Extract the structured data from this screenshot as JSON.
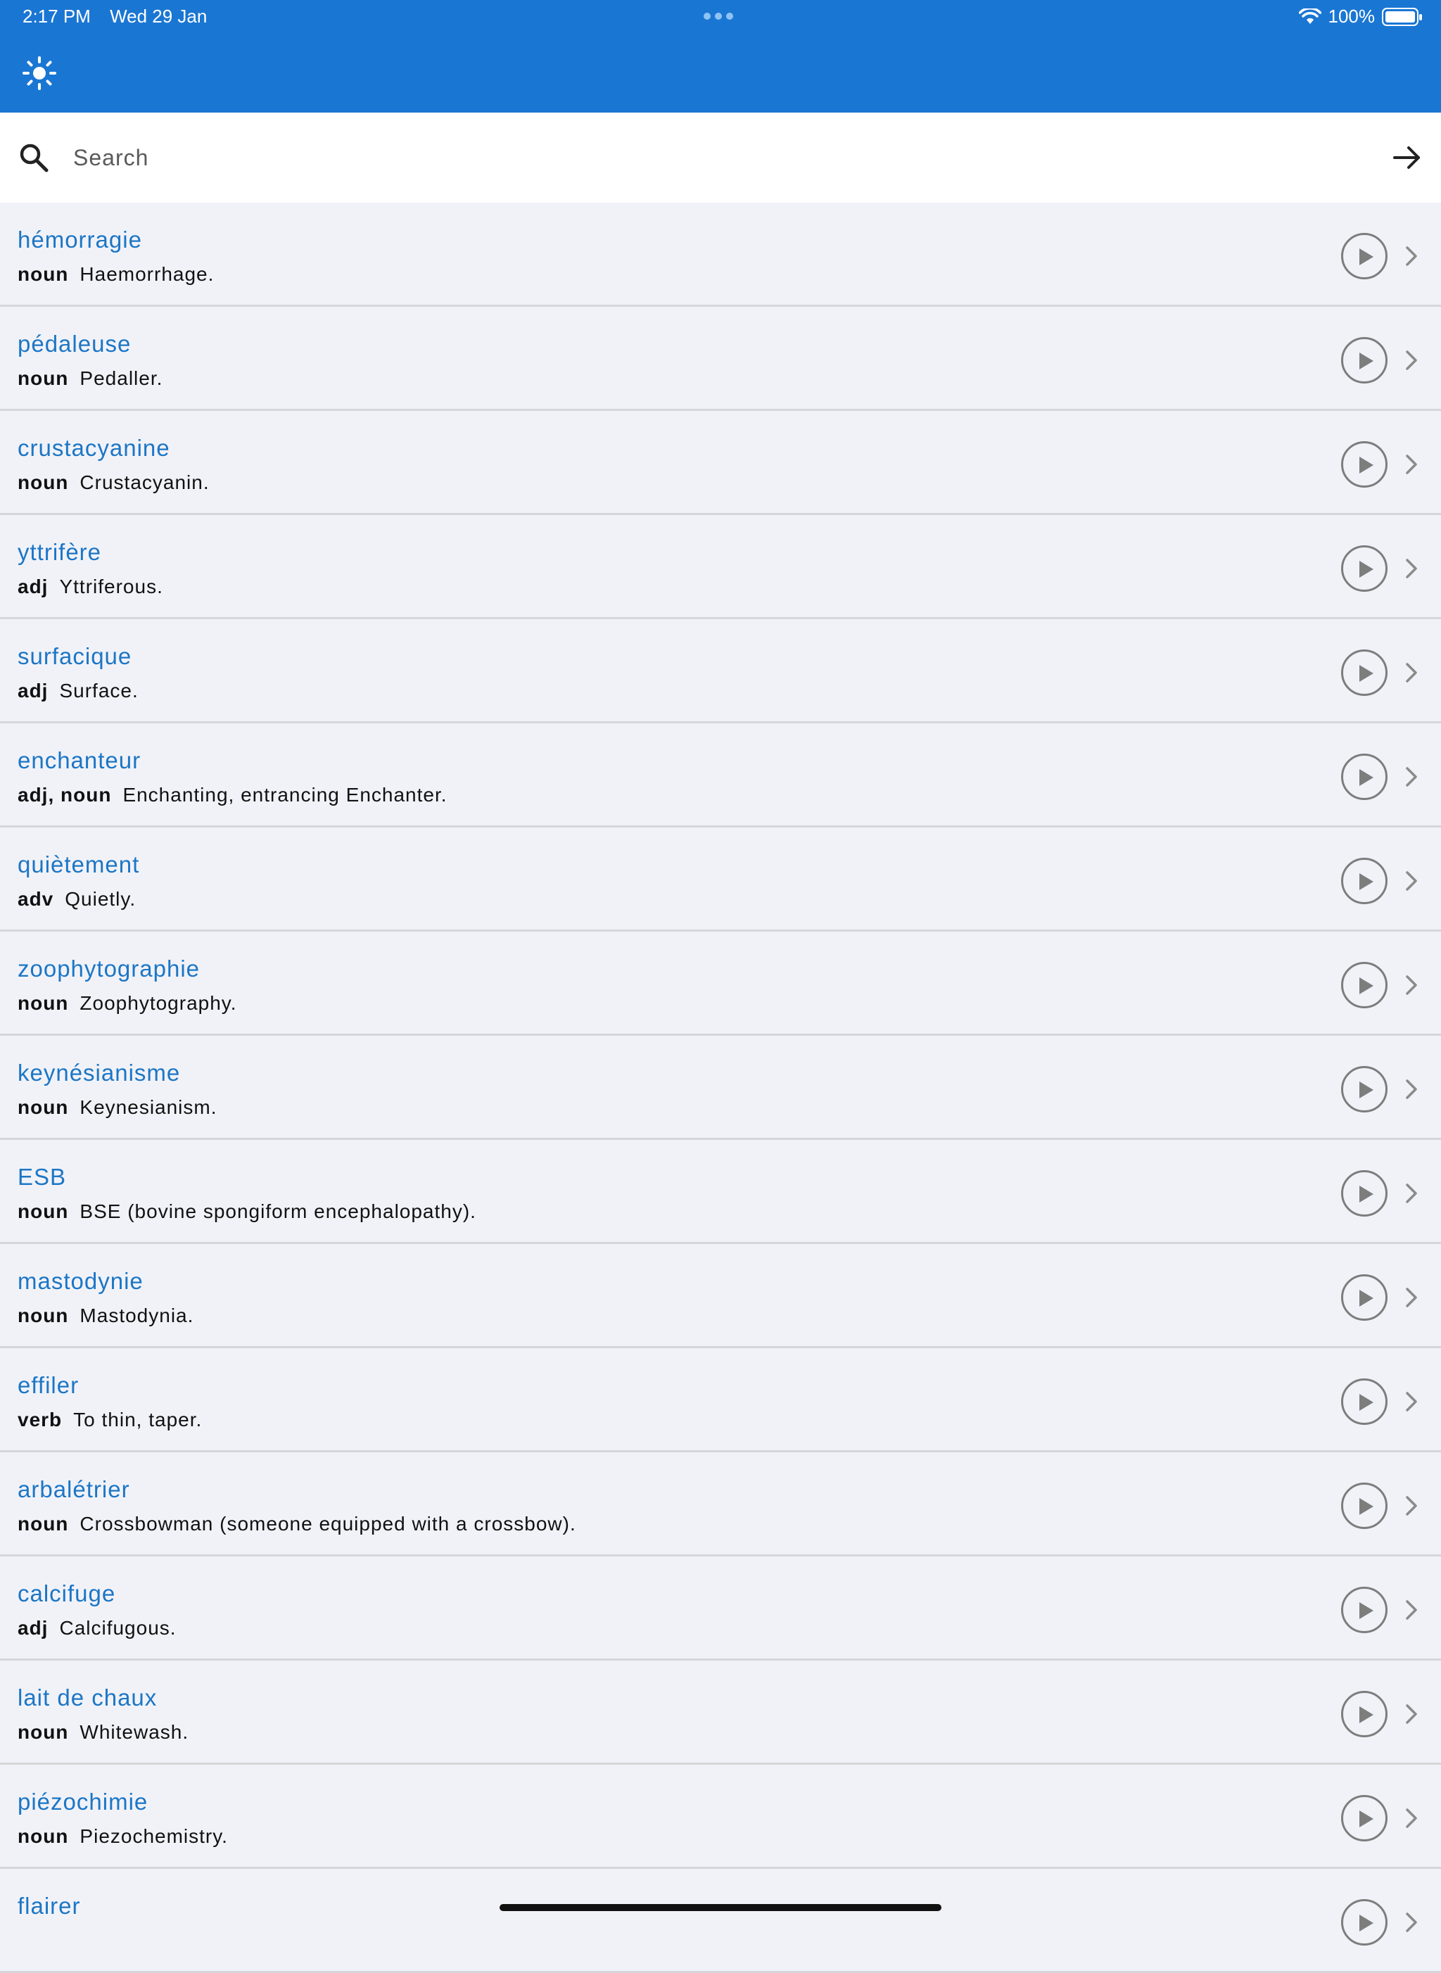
{
  "status_bar": {
    "time": "2:17 PM",
    "date": "Wed 29 Jan",
    "battery": "100%"
  },
  "header": {
    "theme_icon": "sun-icon"
  },
  "search": {
    "placeholder": "Search",
    "value": ""
  },
  "colors": {
    "header": "#1a76d3",
    "word": "#1c76c5",
    "background": "#f1f2f8"
  },
  "entries": [
    {
      "word": "hémorragie",
      "pos": "noun",
      "definition": "Haemorrhage."
    },
    {
      "word": "pédaleuse",
      "pos": "noun",
      "definition": "Pedaller."
    },
    {
      "word": "crustacyanine",
      "pos": "noun",
      "definition": "Crustacyanin."
    },
    {
      "word": "yttrifère",
      "pos": "adj",
      "definition": "Yttriferous."
    },
    {
      "word": "surfacique",
      "pos": "adj",
      "definition": "Surface."
    },
    {
      "word": "enchanteur",
      "pos": "adj, noun",
      "definition": "Enchanting, entrancing Enchanter."
    },
    {
      "word": "quiètement",
      "pos": "adv",
      "definition": "Quietly."
    },
    {
      "word": "zoophytographie",
      "pos": "noun",
      "definition": "Zoophytography."
    },
    {
      "word": "keynésianisme",
      "pos": "noun",
      "definition": "Keynesianism."
    },
    {
      "word": "ESB",
      "pos": "noun",
      "definition": "BSE (bovine spongiform encephalopathy)."
    },
    {
      "word": "mastodynie",
      "pos": "noun",
      "definition": "Mastodynia."
    },
    {
      "word": "effiler",
      "pos": "verb",
      "definition": "To thin, taper."
    },
    {
      "word": "arbalétrier",
      "pos": "noun",
      "definition": "Crossbowman (someone equipped with a crossbow)."
    },
    {
      "word": "calcifuge",
      "pos": "adj",
      "definition": "Calcifugous."
    },
    {
      "word": "lait de chaux",
      "pos": "noun",
      "definition": "Whitewash."
    },
    {
      "word": "piézochimie",
      "pos": "noun",
      "definition": "Piezochemistry."
    },
    {
      "word": "flairer",
      "pos": "",
      "definition": ""
    }
  ]
}
